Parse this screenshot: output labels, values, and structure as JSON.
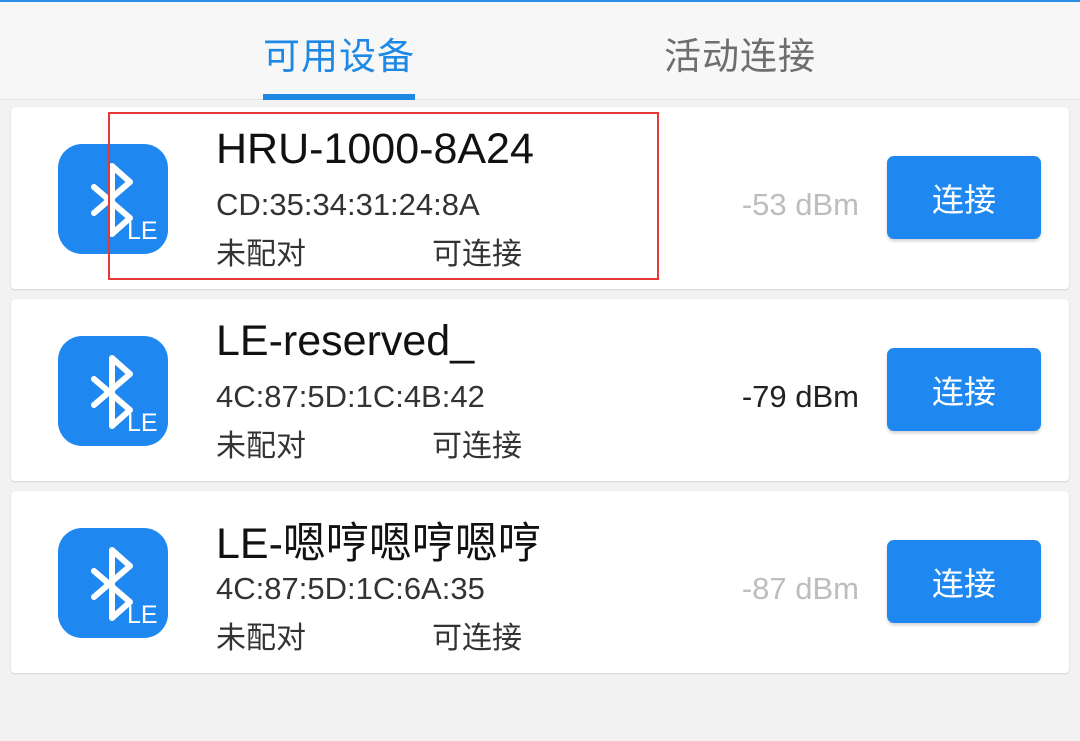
{
  "tabs": [
    {
      "label": "可用设备",
      "active": true
    },
    {
      "label": "活动连接",
      "active": false
    }
  ],
  "accent_color": "#1e88e5",
  "highlight_color": "#e53935",
  "devices": [
    {
      "name": "HRU-1000-8A24",
      "address": "CD:35:34:31:24:8A",
      "pair_status": "未配对",
      "connect_status": "可连接",
      "rssi": "-53 dBm",
      "icon": "bluetooth-le-icon",
      "icon_badge": "LE",
      "button": "连接"
    },
    {
      "name": "LE-reserved_",
      "address": "4C:87:5D:1C:4B:42",
      "pair_status": "未配对",
      "connect_status": "可连接",
      "rssi": "-79 dBm",
      "icon": "bluetooth-le-icon",
      "icon_badge": "LE",
      "button": "连接"
    },
    {
      "name": "LE-嗯哼嗯哼嗯哼",
      "address": "4C:87:5D:1C:6A:35",
      "pair_status": "未配对",
      "connect_status": "可连接",
      "rssi": "-87 dBm",
      "icon": "bluetooth-le-icon",
      "icon_badge": "LE",
      "button": "连接"
    }
  ]
}
